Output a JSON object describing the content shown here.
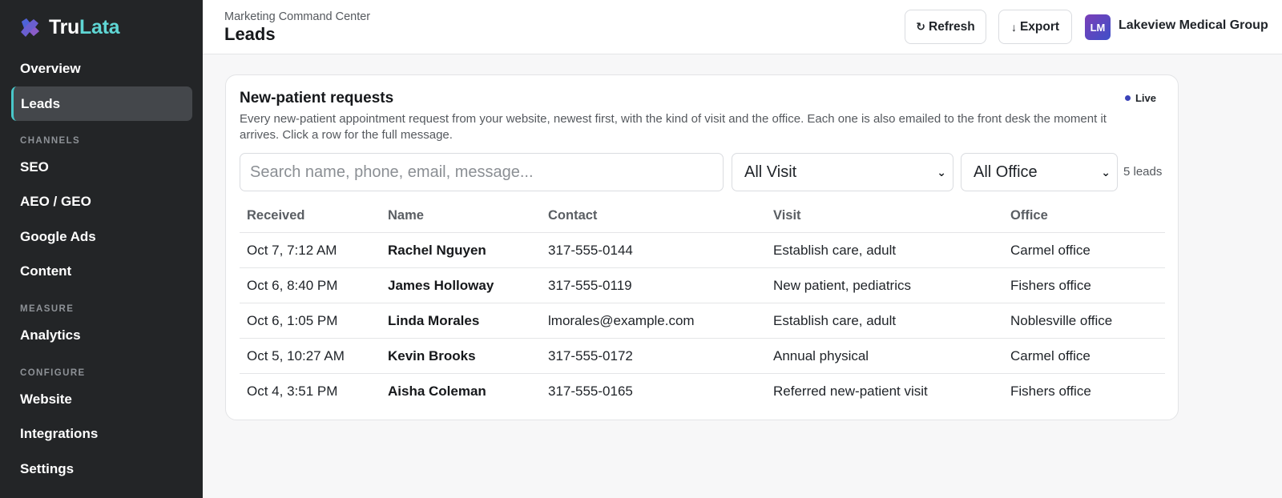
{
  "brand": {
    "name_part1": "Tru",
    "name_part2": "Lata",
    "colors": {
      "accent": "#5fd6d4",
      "logo": "#6a5fd0"
    }
  },
  "sidebar": {
    "items_top": [
      {
        "label": "Overview",
        "active": false
      },
      {
        "label": "Leads",
        "active": true
      }
    ],
    "sections": [
      {
        "title": "CHANNELS",
        "items": [
          "SEO",
          "AEO / GEO",
          "Google Ads",
          "Content"
        ]
      },
      {
        "title": "MEASURE",
        "items": [
          "Analytics"
        ]
      },
      {
        "title": "CONFIGURE",
        "items": [
          "Website",
          "Integrations",
          "Settings"
        ]
      }
    ]
  },
  "header": {
    "breadcrumb": "Marketing Command Center",
    "title": "Leads",
    "refresh_label": "Refresh",
    "export_label": "Export",
    "avatar_initials": "LM",
    "org_name": "Lakeview Medical Group"
  },
  "card": {
    "title": "New-patient requests",
    "live_label": "Live",
    "description": "Every new-patient appointment request from your website, newest first, with the kind of visit and the office. Each one is also emailed to the front desk the moment it arrives. Click a row for the full message.",
    "search_placeholder": "Search name, phone, email, message...",
    "visit_filter": "All Visit",
    "office_filter": "All Office",
    "lead_count": "5 leads",
    "columns": [
      "Received",
      "Name",
      "Contact",
      "Visit",
      "Office"
    ],
    "rows": [
      {
        "received": "Oct 7, 7:12 AM",
        "name": "Rachel Nguyen",
        "contact": "317-555-0144",
        "visit": "Establish care, adult",
        "office": "Carmel office"
      },
      {
        "received": "Oct 6, 8:40 PM",
        "name": "James Holloway",
        "contact": "317-555-0119",
        "visit": "New patient, pediatrics",
        "office": "Fishers office"
      },
      {
        "received": "Oct 6, 1:05 PM",
        "name": "Linda Morales",
        "contact": "lmorales@example.com",
        "visit": "Establish care, adult",
        "office": "Noblesville office"
      },
      {
        "received": "Oct 5, 10:27 AM",
        "name": "Kevin Brooks",
        "contact": "317-555-0172",
        "visit": "Annual physical",
        "office": "Carmel office"
      },
      {
        "received": "Oct 4, 3:51 PM",
        "name": "Aisha Coleman",
        "contact": "317-555-0165",
        "visit": "Referred new-patient visit",
        "office": "Fishers office"
      }
    ]
  }
}
